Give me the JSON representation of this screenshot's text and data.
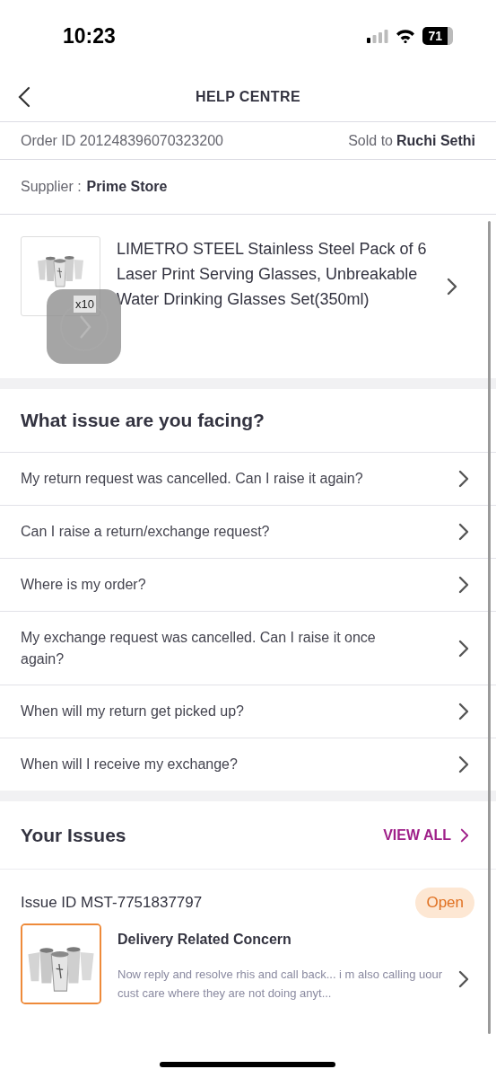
{
  "status_bar": {
    "time": "10:23",
    "battery": "71"
  },
  "header": {
    "title": "HELP CENTRE"
  },
  "order": {
    "order_id": "Order ID 201248396070323200",
    "sold_to_label": "Sold to",
    "buyer": "Ruchi Sethi"
  },
  "supplier": {
    "label": "Supplier :",
    "name": "Prime Store"
  },
  "product": {
    "title": "LIMETRO STEEL Stainless Steel Pack of 6 Laser Print Serving Glasses, Unbreakable Water Drinking Glasses Set(350ml)",
    "quantity": "x10"
  },
  "issues_section": {
    "heading": "What issue are you facing?",
    "items": [
      {
        "text": "My return request was cancelled. Can I raise it again?"
      },
      {
        "text": "Can I raise a return/exchange request?"
      },
      {
        "text": "Where is my order?"
      },
      {
        "text": "My exchange request was cancelled. Can I raise it once again?"
      },
      {
        "text": "When will my return get picked up?"
      },
      {
        "text": "When will I receive my exchange?"
      }
    ]
  },
  "your_issues": {
    "heading": "Your Issues",
    "view_all": "VIEW ALL",
    "issue": {
      "issue_id": "Issue ID MST-7751837797",
      "status": "Open",
      "title": "Delivery Related Concern",
      "message": "Now reply and resolve rhis and call back... i m also calling uour cust care where they are not doing anyt..."
    }
  }
}
